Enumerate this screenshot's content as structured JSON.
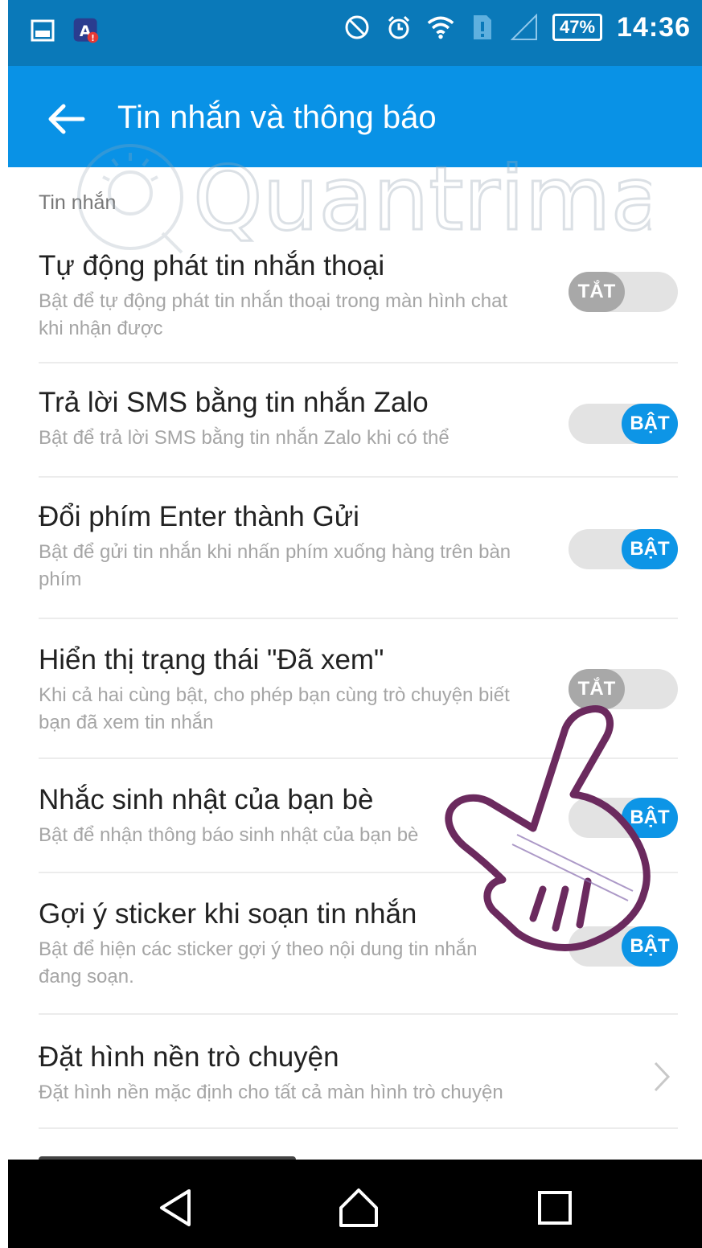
{
  "status_bar": {
    "battery": "47%",
    "time": "14:36",
    "icons": [
      "gallery-icon",
      "app-notification-icon",
      "do-not-disturb-icon",
      "alarm-icon",
      "wifi-icon",
      "sim-icon",
      "signal-icon"
    ]
  },
  "app_bar": {
    "title": "Tin nhắn và thông báo",
    "back_icon": "arrow-left-icon"
  },
  "section": {
    "label": "Tin nhắn"
  },
  "settings": [
    {
      "title": "Tự động phát tin nhắn thoại",
      "description": "Bật để tự động phát tin nhắn thoại trong màn hình chat khi nhận được",
      "toggle_label": "TẮT",
      "enabled": false
    },
    {
      "title": "Trả lời SMS bằng tin nhắn Zalo",
      "description": "Bật để trả lời SMS bằng tin nhắn Zalo khi có thể",
      "toggle_label": "BẬT",
      "enabled": true
    },
    {
      "title": "Đổi phím Enter thành Gửi",
      "description": "Bật để gửi tin nhắn khi nhấn phím xuống hàng trên bàn phím",
      "toggle_label": "BẬT",
      "enabled": true
    },
    {
      "title": "Hiển thị trạng thái \"Đã xem\"",
      "description": "Khi cả hai cùng bật, cho phép bạn cùng trò chuyện biết bạn đã xem tin nhắn",
      "toggle_label": "TẮT",
      "enabled": false
    },
    {
      "title": "Nhắc sinh nhật của bạn bè",
      "description": "Bật để nhận thông báo sinh nhật của bạn bè",
      "toggle_label": "BẬT",
      "enabled": true
    },
    {
      "title": "Gợi ý sticker khi soạn tin nhắn",
      "description": "Bật để hiện các sticker gợi ý theo nội dung tin nhắn đang soạn.",
      "toggle_label": "BẬT",
      "enabled": true
    }
  ],
  "wallpaper_item": {
    "title": "Đặt hình nền trò chuyện",
    "description": "Đặt hình nền mặc định cho tất cả màn hình trò chuyện",
    "icon": "chevron-right-icon"
  },
  "watermark": {
    "text": "Quantrimang"
  },
  "colors": {
    "status_bar": "#0a79b9",
    "app_bar": "#0992e6",
    "toggle_on": "#0d95e6",
    "toggle_off": "#a8a8a8",
    "hand_outline": "#6b2a5e"
  },
  "nav_bar": {
    "buttons": [
      "back-triangle-icon",
      "home-icon",
      "recents-icon"
    ]
  }
}
